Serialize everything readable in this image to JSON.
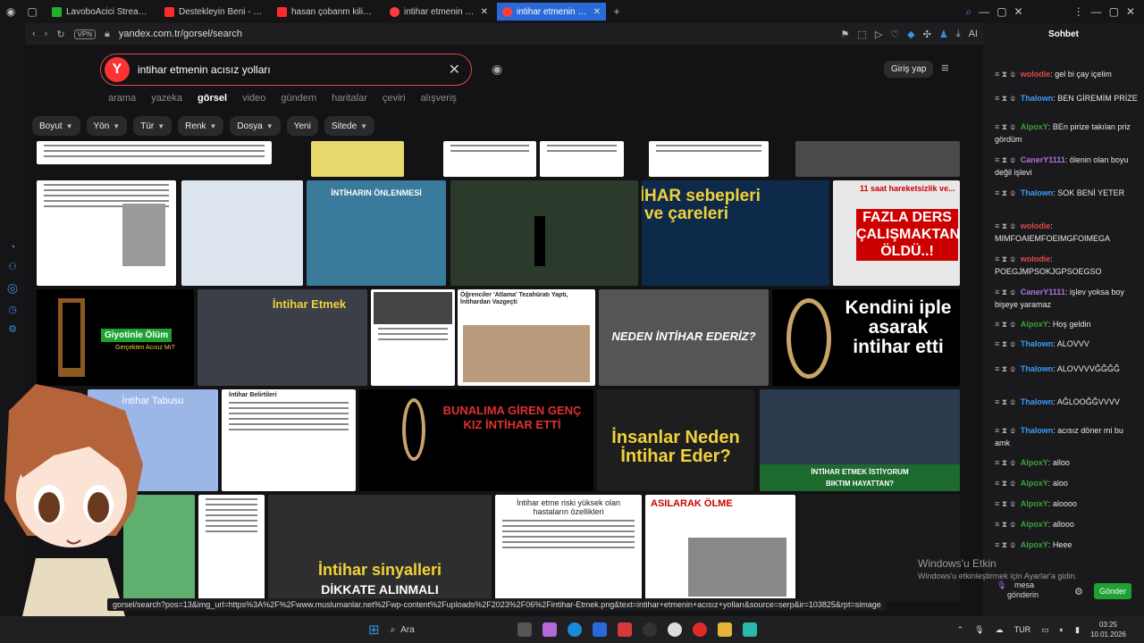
{
  "browser": {
    "tabs": [
      {
        "label": "LavoboAcici Stream - Wat",
        "color": "#20b12d"
      },
      {
        "label": "Destekleyin Beni - YouTub",
        "color": "#ff2a2a"
      },
      {
        "label": "hasan çobanm kilis - YouT",
        "color": "#ff2a2a"
      },
      {
        "label": "intihar etmenin acısız yollo",
        "color": "#ff3b3b"
      },
      {
        "label": "intihar etmenin acısız yollo",
        "color": "#ff3b3b"
      }
    ],
    "active_tab": 4,
    "vpn": "VPN",
    "url": "yandex.com.tr/gorsel/search",
    "ai": "AI",
    "side_vpn": "VPN",
    "side_url": "kick."
  },
  "search": {
    "logo": "Y",
    "query": "intihar etmenin acısız yolları",
    "login": "Giriş yap",
    "services": [
      "arama",
      "yazeka",
      "görsel",
      "video",
      "gündem",
      "haritalar",
      "çeviri",
      "alışveriş"
    ],
    "active_service": "görsel",
    "filters": [
      "Boyut",
      "Yön",
      "Tür",
      "Renk",
      "Dosya",
      "Yeni",
      "Sitede"
    ]
  },
  "tiles": {
    "bunalima": "BUNALIMA GİREN GENÇ KIZ İNTİHAR ETTİ",
    "sebepleri": "İNTİHAR sebepleri ve çareleri",
    "fazla1": "11 saat hareketsizlik ve...",
    "fazla2": "FAZLA DERS ÇALIŞMAKTAN ÖLDÜ..!",
    "giyotin1": "Giyotinle Ölüm",
    "giyotin2": "Gerçekten Acısız Mı?",
    "etmek": "İntihar Etmek",
    "ogrenciler": "Öğrenciler 'Atlama' Tezahüratı Yaptı, İntihardan Vazgeçti",
    "neden": "NEDEN İNTİHAR EDERİZ?",
    "kendini": "Kendini iple asarak intihar etti",
    "insanlar": "İnsanlar Neden İntihar Eder?",
    "istiyorum1": "İNTİHAR ETMEK İSTİYORUM",
    "istiyorum2": "BIKTIM HAYATTAN?",
    "sinyaller1": "İntihar sinyalleri",
    "sinyaller2": "DİKKATE ALINMALI",
    "asilarak1": "ASILARAK ÖLME",
    "risk": "İntihar etme riski yüksek olan hastaların özellikleri",
    "onlenmesi": "İNTİHARIN ÖNLENMESİ",
    "tabusu": "İntihar Tabusu",
    "belirtileri": "İntihar Belirtileri"
  },
  "chat": {
    "title": "Sohbet",
    "messages": [
      {
        "user": "wolodie",
        "text": "gel bi çay içelim",
        "color": "#e04848"
      },
      {
        "user": "Thalown",
        "text": "BEN GİREMİM PRİZE",
        "color": "#3a9cf5"
      },
      {
        "user": "AlpoxY",
        "text": "BEn pirize takılan priz gördüm",
        "color": "#3aa13a"
      },
      {
        "user": "CanerY1111",
        "text": "ölenin olan boyu değil işlevi",
        "color": "#b06fe0"
      },
      {
        "user": "Thalown",
        "text": "SOK BENİ YETER",
        "color": "#3a9cf5"
      },
      {
        "user": "wolodie",
        "text": "MIMFOAIEMFOEIMGFOIMEGA",
        "color": "#e04848"
      },
      {
        "user": "wolodie",
        "text": "POEGJMPSOKJGPSOEGSO",
        "color": "#e04848"
      },
      {
        "user": "CanerY1111",
        "text": "işlev yoksa boy bişeye yaramaz",
        "color": "#b06fe0"
      },
      {
        "user": "AlpoxY",
        "text": "Hoş geldin",
        "color": "#3aa13a"
      },
      {
        "user": "Thalown",
        "text": "ALOVVV",
        "color": "#3a9cf5"
      },
      {
        "user": "Thalown",
        "text": "ALOVVVVĞĞĞĞ",
        "color": "#3a9cf5"
      },
      {
        "user": "Thalown",
        "text": "AĞLOOĞĞVVVV",
        "color": "#3a9cf5"
      },
      {
        "user": "Thalown",
        "text": "acısız döner mi bu amk",
        "color": "#3a9cf5"
      },
      {
        "user": "AlpoxY",
        "text": "alloo",
        "color": "#3aa13a"
      },
      {
        "user": "AlpoxY",
        "text": "aloo",
        "color": "#3aa13a"
      },
      {
        "user": "AlpoxY",
        "text": "aloooo",
        "color": "#3aa13a"
      },
      {
        "user": "AlpoxY",
        "text": "allooo",
        "color": "#3aa13a"
      },
      {
        "user": "AlpoxY",
        "text": "Heee",
        "color": "#3aa13a"
      }
    ],
    "input_line1": "mesa",
    "input_line2": "gönderin",
    "send": "Gönder"
  },
  "watermark": {
    "line1": "Windows'u Etkin",
    "line2": "Windows'u etkinleştirmek için Ayarlar'a gidin."
  },
  "status_url": "gorsel/search?pos=13&img_url=https%3A%2F%2Fwww.muslumanlar.net%2Fwp-content%2Fuploads%2F2023%2F06%2Fintihar-Etmek.png&text=intihar+etmenin+acısız+yolları&source=serp&ir=103825&rpt=simage",
  "taskbar": {
    "search": "Ara",
    "lang": "TUR",
    "time": "03:25",
    "date": "10.01.2026"
  }
}
